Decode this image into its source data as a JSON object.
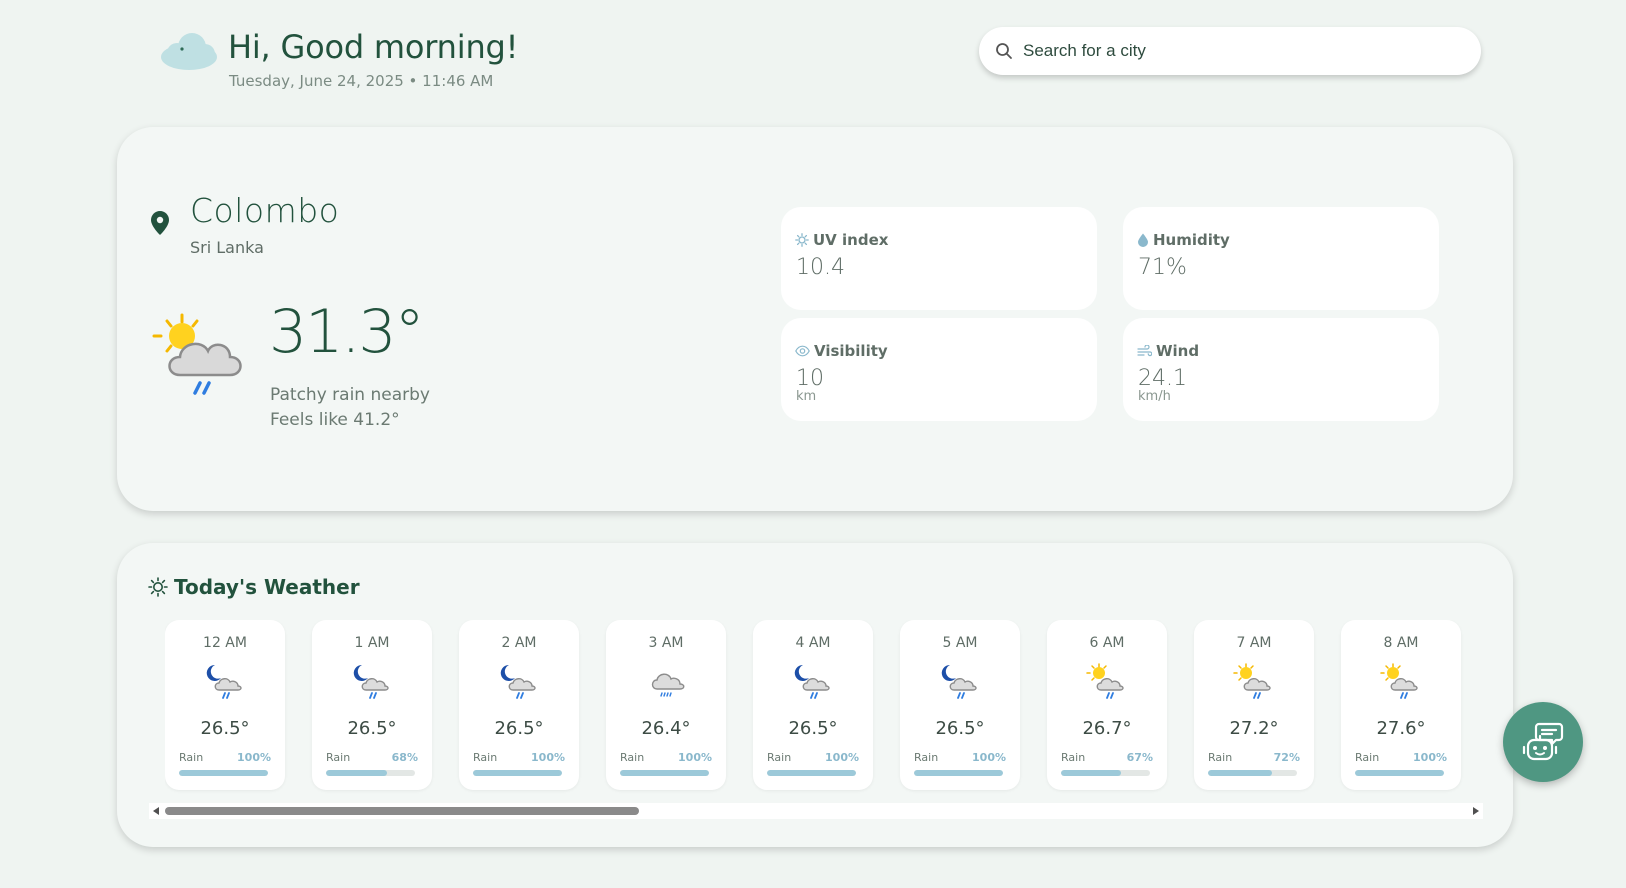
{
  "header": {
    "logo_icon": "cloud-icon",
    "greeting": "Hi, Good morning!",
    "datetime": "Tuesday, June 24, 2025 • 11:46 AM"
  },
  "search": {
    "placeholder": "Search for a city",
    "icon": "search-icon"
  },
  "current": {
    "city": "Colombo",
    "country": "Sri Lanka",
    "temperature": "31.3°",
    "condition": "Patchy rain nearby",
    "feels_like": "Feels like 41.2°",
    "icon": "sun-cloud-rain-icon"
  },
  "stats": {
    "uv": {
      "label": "UV index",
      "value": "10.4",
      "icon": "sun-icon"
    },
    "humidity": {
      "label": "Humidity",
      "value": "71%",
      "icon": "droplet-icon"
    },
    "visibility": {
      "label": "Visibility",
      "value": "10",
      "unit": "km",
      "icon": "eye-icon"
    },
    "wind": {
      "label": "Wind",
      "value": "24.1",
      "unit": "km/h",
      "icon": "wind-icon"
    }
  },
  "forecast": {
    "title": "Today's Weather",
    "title_icon": "sun-icon",
    "rain_label": "Rain",
    "hours": [
      {
        "time": "12 AM",
        "temp": "26.5°",
        "rain": "100%",
        "rain_fraction": 1.0,
        "icon": "moon-cloud-rain-icon"
      },
      {
        "time": "1 AM",
        "temp": "26.5°",
        "rain": "68%",
        "rain_fraction": 0.68,
        "icon": "moon-cloud-rain-icon"
      },
      {
        "time": "2 AM",
        "temp": "26.5°",
        "rain": "100%",
        "rain_fraction": 1.0,
        "icon": "moon-cloud-rain-icon"
      },
      {
        "time": "3 AM",
        "temp": "26.4°",
        "rain": "100%",
        "rain_fraction": 1.0,
        "icon": "cloud-drizzle-icon"
      },
      {
        "time": "4 AM",
        "temp": "26.5°",
        "rain": "100%",
        "rain_fraction": 1.0,
        "icon": "moon-cloud-rain-icon"
      },
      {
        "time": "5 AM",
        "temp": "26.5°",
        "rain": "100%",
        "rain_fraction": 1.0,
        "icon": "moon-cloud-rain-icon"
      },
      {
        "time": "6 AM",
        "temp": "26.7°",
        "rain": "67%",
        "rain_fraction": 0.67,
        "icon": "sun-cloud-rain-icon"
      },
      {
        "time": "7 AM",
        "temp": "27.2°",
        "rain": "72%",
        "rain_fraction": 0.72,
        "icon": "sun-cloud-rain-icon"
      },
      {
        "time": "8 AM",
        "temp": "27.6°",
        "rain": "100%",
        "rain_fraction": 1.0,
        "icon": "sun-cloud-rain-icon"
      }
    ]
  },
  "chat": {
    "icon": "chatbot-icon"
  },
  "colors": {
    "background": "#eff4f1",
    "primary_text": "#22523d",
    "accent": "#4f9782",
    "rain_bar": "#9cc9d9"
  }
}
